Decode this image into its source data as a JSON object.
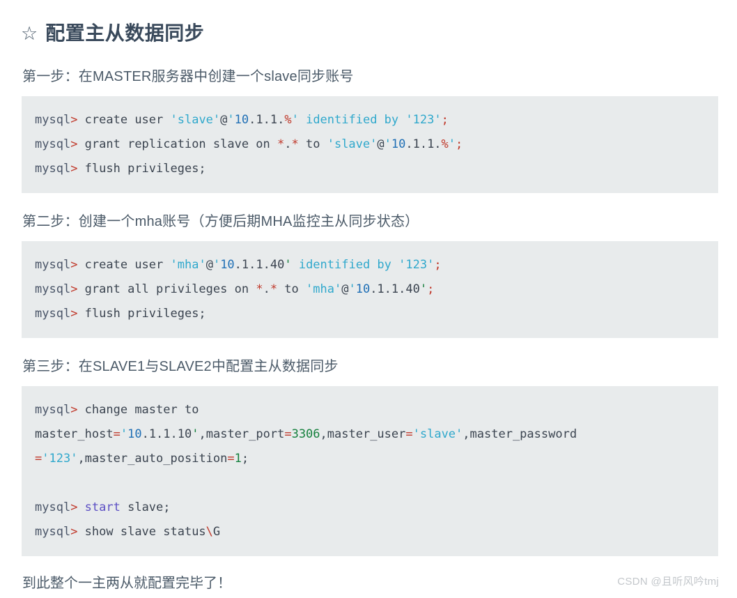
{
  "document": {
    "title": "配置主从数据同步",
    "star_icon": "☆",
    "sections": [
      {
        "heading": "第一步：在MASTER服务器中创建一个slave同步账号",
        "code_lines": [
          "mysql> create user 'slave'@'10.1.1.%' identified by '123';",
          "mysql> grant replication slave on *.* to 'slave'@'10.1.1.%';",
          "mysql> flush privileges;"
        ]
      },
      {
        "heading": "第二步：创建一个mha账号（方便后期MHA监控主从同步状态）",
        "code_lines": [
          "mysql> create user 'mha'@'10.1.1.40' identified by '123';",
          "mysql> grant all privileges on *.* to 'mha'@'10.1.1.40';",
          "mysql> flush privileges;"
        ]
      },
      {
        "heading": "第三步：在SLAVE1与SLAVE2中配置主从数据同步",
        "code_lines": [
          "mysql> change master to",
          "master_host='10.1.1.10',master_port=3306,master_user='slave',master_password",
          "='123',master_auto_position=1;",
          "",
          "mysql> start slave;",
          "mysql> show slave status\\G"
        ]
      }
    ],
    "closing_text": "到此整个一主两从就配置完毕了！",
    "watermark": "CSDN @且听风吟tmj"
  },
  "code_tokens": {
    "block1": [
      [
        [
          "mysql",
          "t-prompt"
        ],
        [
          "> ",
          "t-arrow"
        ],
        [
          "create user ",
          "t-plain"
        ],
        [
          "'slave'",
          "t-str"
        ],
        [
          "@",
          "t-plain"
        ],
        [
          "'",
          "t-str"
        ],
        [
          "10",
          "t-num"
        ],
        [
          ".1.1.",
          "t-plain"
        ],
        [
          "%",
          "t-red"
        ],
        [
          "'",
          "t-str"
        ],
        [
          " ",
          "t-plain"
        ],
        [
          "identified by",
          "t-kw"
        ],
        [
          " ",
          "t-plain"
        ],
        [
          "'123'",
          "t-str"
        ],
        [
          ";",
          "t-red"
        ]
      ],
      [
        [
          "mysql",
          "t-prompt"
        ],
        [
          "> ",
          "t-arrow"
        ],
        [
          "grant replication slave on ",
          "t-plain"
        ],
        [
          "*",
          "t-red"
        ],
        [
          ".",
          "t-plain"
        ],
        [
          "*",
          "t-red"
        ],
        [
          " to ",
          "t-plain"
        ],
        [
          "'slave'",
          "t-str"
        ],
        [
          "@",
          "t-plain"
        ],
        [
          "'",
          "t-str"
        ],
        [
          "10",
          "t-num"
        ],
        [
          ".1.1.",
          "t-plain"
        ],
        [
          "%",
          "t-red"
        ],
        [
          "'",
          "t-str"
        ],
        [
          ";",
          "t-red"
        ]
      ],
      [
        [
          "mysql",
          "t-prompt"
        ],
        [
          "> ",
          "t-arrow"
        ],
        [
          "flush privileges;",
          "t-plain"
        ]
      ]
    ],
    "block2": [
      [
        [
          "mysql",
          "t-prompt"
        ],
        [
          "> ",
          "t-arrow"
        ],
        [
          "create user ",
          "t-plain"
        ],
        [
          "'mha'",
          "t-str"
        ],
        [
          "@",
          "t-plain"
        ],
        [
          "'",
          "t-str"
        ],
        [
          "10",
          "t-num"
        ],
        [
          ".1.1.40",
          "t-plain"
        ],
        [
          "'",
          "t-quote-g"
        ],
        [
          " ",
          "t-plain"
        ],
        [
          "identified by",
          "t-kw"
        ],
        [
          " ",
          "t-plain"
        ],
        [
          "'123'",
          "t-str"
        ],
        [
          ";",
          "t-red"
        ]
      ],
      [
        [
          "mysql",
          "t-prompt"
        ],
        [
          "> ",
          "t-arrow"
        ],
        [
          "grant all privileges on ",
          "t-plain"
        ],
        [
          "*",
          "t-red"
        ],
        [
          ".",
          "t-plain"
        ],
        [
          "*",
          "t-red"
        ],
        [
          " to ",
          "t-plain"
        ],
        [
          "'mha'",
          "t-str"
        ],
        [
          "@",
          "t-plain"
        ],
        [
          "'",
          "t-str"
        ],
        [
          "10",
          "t-num"
        ],
        [
          ".1.1.40",
          "t-plain"
        ],
        [
          "'",
          "t-quote-g"
        ],
        [
          ";",
          "t-red"
        ]
      ],
      [
        [
          "mysql",
          "t-prompt"
        ],
        [
          "> ",
          "t-arrow"
        ],
        [
          "flush privileges;",
          "t-plain"
        ]
      ]
    ],
    "block3": [
      [
        [
          "mysql",
          "t-prompt"
        ],
        [
          "> ",
          "t-arrow"
        ],
        [
          "change master to",
          "t-plain"
        ]
      ],
      [
        [
          "master_host",
          "t-plain"
        ],
        [
          "=",
          "t-eq"
        ],
        [
          "'",
          "t-str"
        ],
        [
          "10",
          "t-num"
        ],
        [
          ".1.1.10",
          "t-plain"
        ],
        [
          "'",
          "t-quote-g"
        ],
        [
          ",",
          "t-plain"
        ],
        [
          "master_port",
          "t-plain"
        ],
        [
          "=",
          "t-eq"
        ],
        [
          "3306",
          "t-green"
        ],
        [
          ",",
          "t-plain"
        ],
        [
          "master_user",
          "t-plain"
        ],
        [
          "=",
          "t-eq"
        ],
        [
          "'slave'",
          "t-str"
        ],
        [
          ",",
          "t-plain"
        ],
        [
          "master_password",
          "t-plain"
        ]
      ],
      [
        [
          "=",
          "t-eq"
        ],
        [
          "'123'",
          "t-str"
        ],
        [
          ",",
          "t-plain"
        ],
        [
          "master_auto_position",
          "t-plain"
        ],
        [
          "=",
          "t-eq"
        ],
        [
          "1",
          "t-green"
        ],
        [
          ";",
          "t-plain"
        ]
      ],
      [],
      [
        [
          "mysql",
          "t-prompt"
        ],
        [
          "> ",
          "t-arrow"
        ],
        [
          "start",
          "t-purple"
        ],
        [
          " slave;",
          "t-plain"
        ]
      ],
      [
        [
          "mysql",
          "t-prompt"
        ],
        [
          "> ",
          "t-arrow"
        ],
        [
          "show slave status",
          "t-plain"
        ],
        [
          "\\",
          "t-red"
        ],
        [
          "G",
          "t-plain"
        ]
      ]
    ]
  }
}
